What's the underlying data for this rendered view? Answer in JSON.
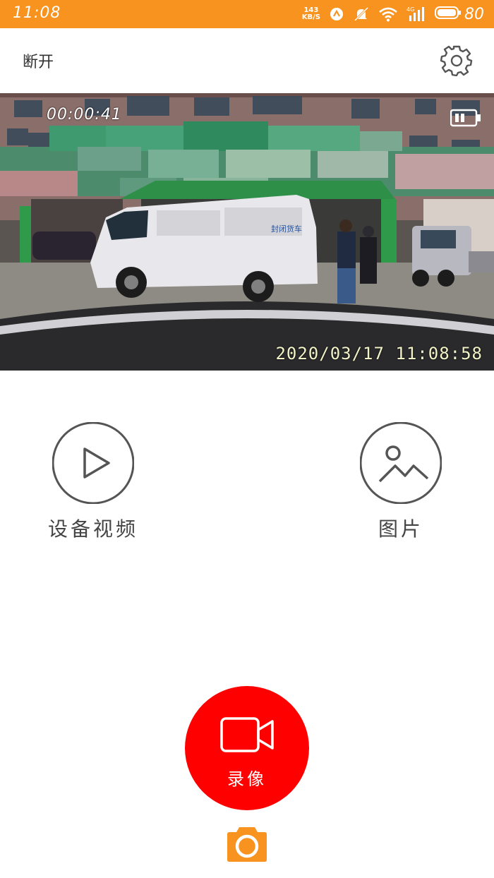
{
  "status_bar": {
    "time": "11:08",
    "net_speed_value": "143",
    "net_speed_unit": "KB/S",
    "battery": "80",
    "icons": [
      "nfc-icon",
      "mute-icon",
      "wifi-icon",
      "signal-4g-icon",
      "battery-icon"
    ]
  },
  "header": {
    "disconnect_label": "断开",
    "settings_icon": "gear-icon"
  },
  "preview": {
    "elapsed": "00:00:41",
    "timestamp": "2020/03/17  11:08:58",
    "van_text": "封闭货车",
    "battery_icon": "battery-icon"
  },
  "actions": {
    "device_video_label": "设备视频",
    "pictures_label": "图片"
  },
  "record": {
    "label": "录像"
  },
  "colors": {
    "status_bar": "#f7931e",
    "record_button": "#ff0000",
    "snap_button": "#f7931e",
    "icon_stroke": "#555555"
  }
}
